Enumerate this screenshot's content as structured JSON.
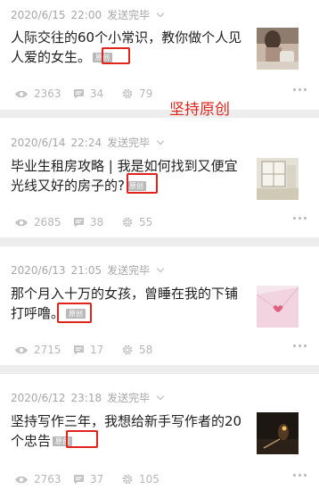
{
  "annotation": "坚持原创",
  "articles": [
    {
      "date": "2020/6/15",
      "time": "22:00",
      "status": "发送完毕",
      "title": "人际交往的60个小常识，教你做个人见人爱的女生。",
      "tag": "原创",
      "views": "2363",
      "comments": "34",
      "likes": "79",
      "thumbnail": "woman-with-bag-photo"
    },
    {
      "date": "2020/6/14",
      "time": "22:24",
      "status": "发送完毕",
      "title": "毕业生租房攻略 | 我是如何找到又便宜光线又好的房子的?",
      "tag": "原创",
      "views": "2685",
      "comments": "38",
      "likes": "55",
      "thumbnail": "window-room-photo"
    },
    {
      "date": "2020/6/13",
      "time": "21:05",
      "status": "发送完毕",
      "title": "那个月入十万的女孩，曾睡在我的下铺打呼噜。",
      "tag": "原创",
      "views": "2715",
      "comments": "17",
      "likes": "58",
      "thumbnail": "pink-envelope-photo"
    },
    {
      "date": "2020/6/12",
      "time": "23:18",
      "status": "发送完毕",
      "title": "坚持写作三年，我想给新手写作者的20个忠告",
      "tag": "原创",
      "views": "2763",
      "comments": "37",
      "likes": "105",
      "thumbnail": "dark-desk-photo"
    }
  ],
  "icons": {
    "views": "eye-icon",
    "comments": "comment-icon",
    "likes": "gear-like-icon",
    "more": "more-dots-icon"
  },
  "colors": {
    "highlight": "#e0241b",
    "meta": "#a7a7a7",
    "tag_bg": "#b9b9b9"
  }
}
